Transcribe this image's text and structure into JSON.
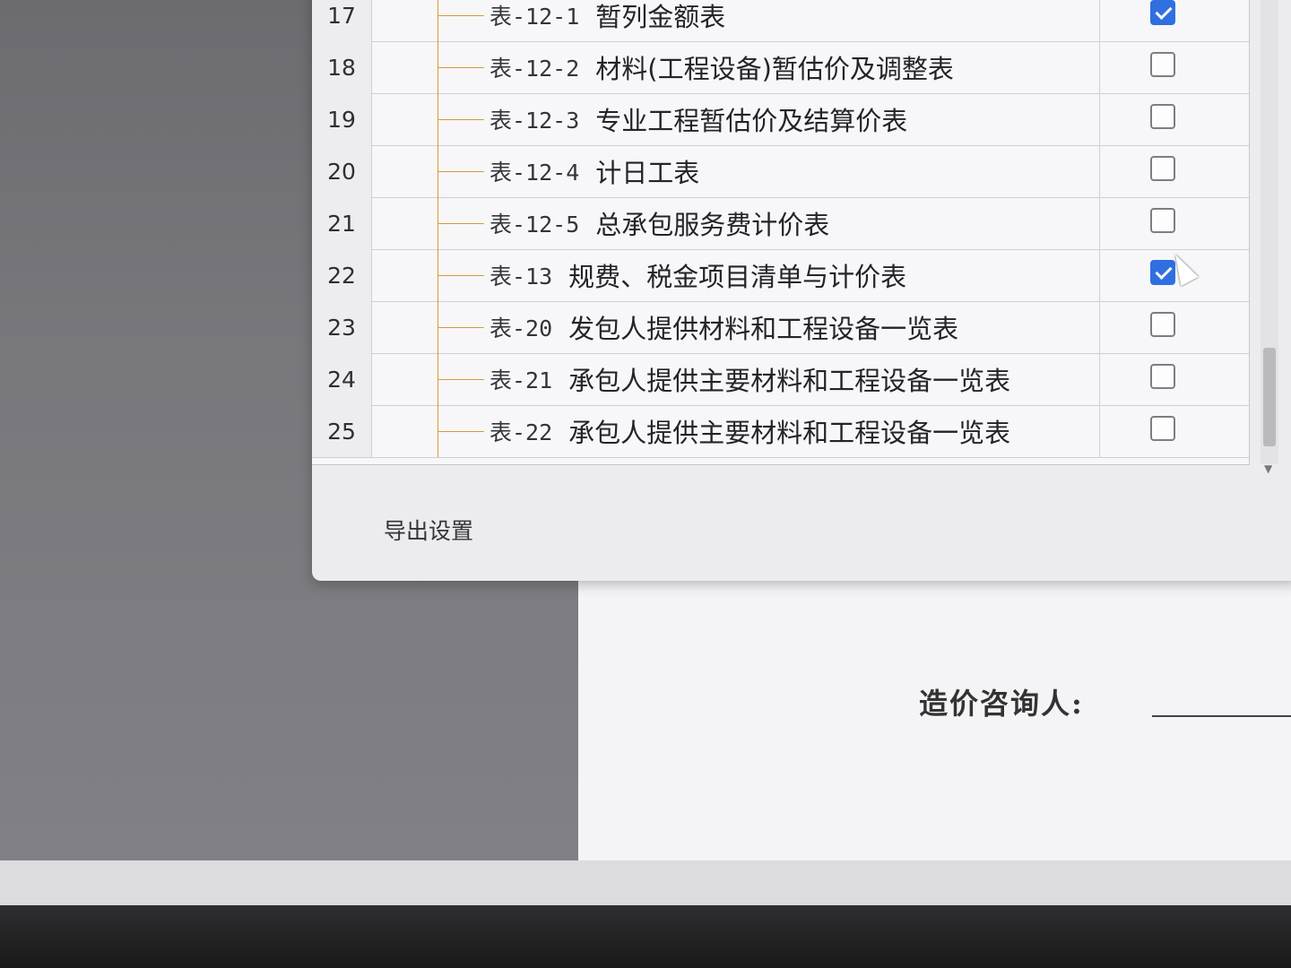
{
  "dialog": {
    "rows": [
      {
        "num": "17",
        "code": "表-12-1",
        "title": "暂列金额表",
        "checked": true
      },
      {
        "num": "18",
        "code": "表-12-2",
        "title": "材料(工程设备)暂估价及调整表",
        "checked": false
      },
      {
        "num": "19",
        "code": "表-12-3",
        "title": "专业工程暂估价及结算价表",
        "checked": false
      },
      {
        "num": "20",
        "code": "表-12-4",
        "title": "计日工表",
        "checked": false
      },
      {
        "num": "21",
        "code": "表-12-5",
        "title": "总承包服务费计价表",
        "checked": false
      },
      {
        "num": "22",
        "code": "表-13",
        "title": "规费、税金项目清单与计价表",
        "checked": true
      },
      {
        "num": "23",
        "code": "表-20",
        "title": "发包人提供材料和工程设备一览表",
        "checked": false
      },
      {
        "num": "24",
        "code": "表-21",
        "title": "承包人提供主要材料和工程设备一览表",
        "checked": false
      },
      {
        "num": "25",
        "code": "表-22",
        "title": "承包人提供主要材料和工程设备一览表",
        "checked": false
      }
    ],
    "export_settings_label": "导出设置"
  },
  "document": {
    "consultant_label": "造价咨询人:"
  },
  "colors": {
    "checkbox_checked": "#2f6fe0",
    "tree_line": "#d59a38"
  }
}
